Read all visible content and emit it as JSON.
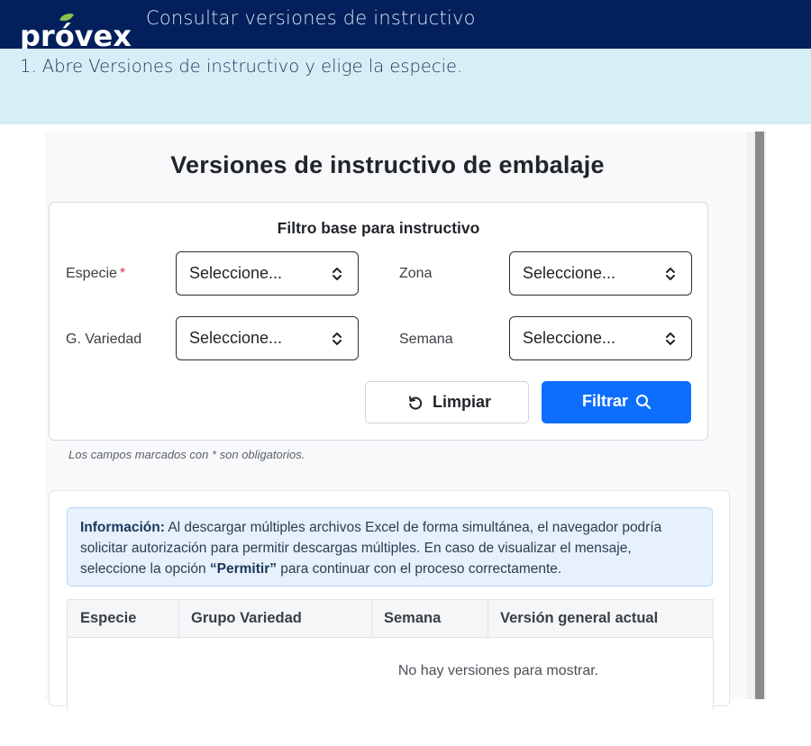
{
  "header": {
    "brand": "próvex",
    "title": "Consultar versiones de instructivo",
    "accent_color": "#8bc34a",
    "bg_color": "#03205c"
  },
  "step": {
    "text": "1. Abre Versiones de instructivo y elige la especie."
  },
  "page": {
    "title": "Versiones de instructivo de embalaje"
  },
  "filter": {
    "title": "Filtro base para instructivo",
    "fields": [
      {
        "label": "Especie",
        "required_mark": "*",
        "value": "Seleccione..."
      },
      {
        "label": "Zona",
        "value": "Seleccione..."
      },
      {
        "label": "G. Variedad",
        "value": "Seleccione..."
      },
      {
        "label": "Semana",
        "value": "Seleccione..."
      }
    ],
    "clear_label": "Limpiar",
    "filter_label": "Filtrar",
    "primary_color": "#0d6efd"
  },
  "note": {
    "text": "Los campos marcados con * son obligatorios."
  },
  "info": {
    "strong": "Información:",
    "text1": " Al descargar múltiples archivos Excel de forma simultánea, el navegador podría solicitar autorización para permitir descargas múltiples. En caso de visualizar el mensaje, seleccione la opción ",
    "strong2": "“Permitir”",
    "text2": " para continuar con el proceso correctamente."
  },
  "table": {
    "columns": [
      "Especie",
      "Grupo Variedad",
      "Semana",
      "Versión general actual"
    ],
    "empty_message": "No hay versiones para mostrar."
  }
}
